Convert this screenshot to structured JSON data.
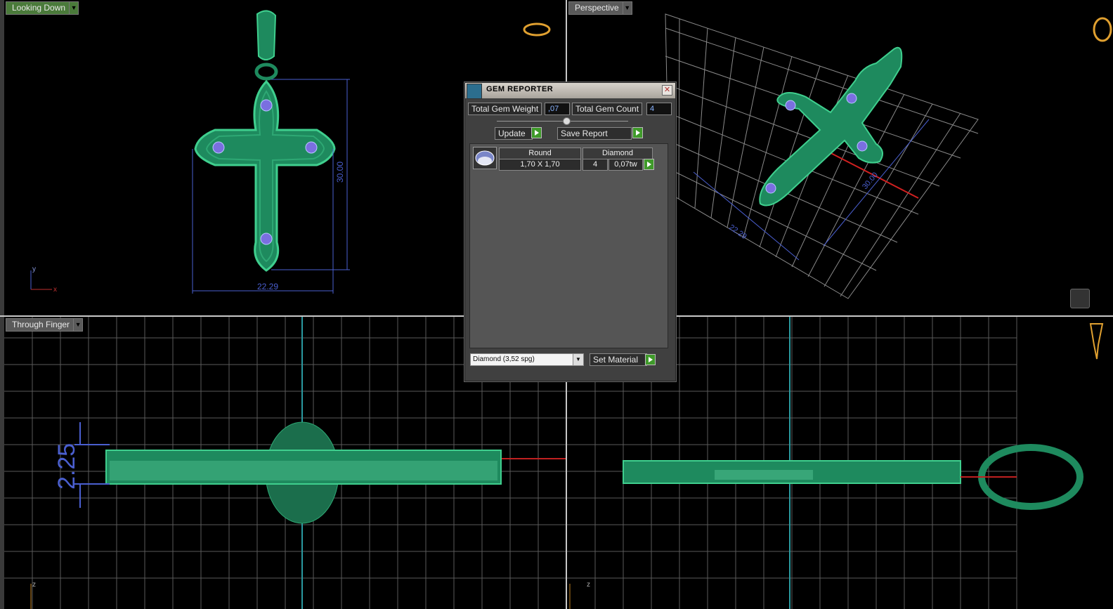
{
  "viewports": {
    "top_left": {
      "label": "Looking Down",
      "dim_width": "22.29",
      "dim_height": "30.00",
      "axis_y": "y",
      "axis_x": "x"
    },
    "top_right": {
      "label": "Perspective",
      "dim_width": "22.29",
      "dim_height": "30.00"
    },
    "bottom_left": {
      "label": "Through Finger",
      "dim_thickness": "2.25",
      "axis_z": "z"
    },
    "bottom_right": {
      "axis_z": "z"
    }
  },
  "gem_reporter": {
    "title": "GEM REPORTER",
    "total_weight_label": "Total Gem Weight",
    "total_weight_value": ",07",
    "total_count_label": "Total Gem Count",
    "total_count_value": "4",
    "update_label": "Update",
    "save_report_label": "Save Report",
    "table": {
      "header_shape": "Round",
      "header_material": "Diamond",
      "size": "1,70 X 1,70",
      "count": "4",
      "weight": "0,07tw"
    },
    "material_select": "Diamond    (3,52 spg)",
    "set_material_label": "Set Material"
  },
  "colors": {
    "model": "#1e8a5e",
    "model_light": "#3fcf8e",
    "dimension": "#4a5fd0",
    "gem": "#7a4fd0",
    "grid": "#9a9a9a"
  }
}
